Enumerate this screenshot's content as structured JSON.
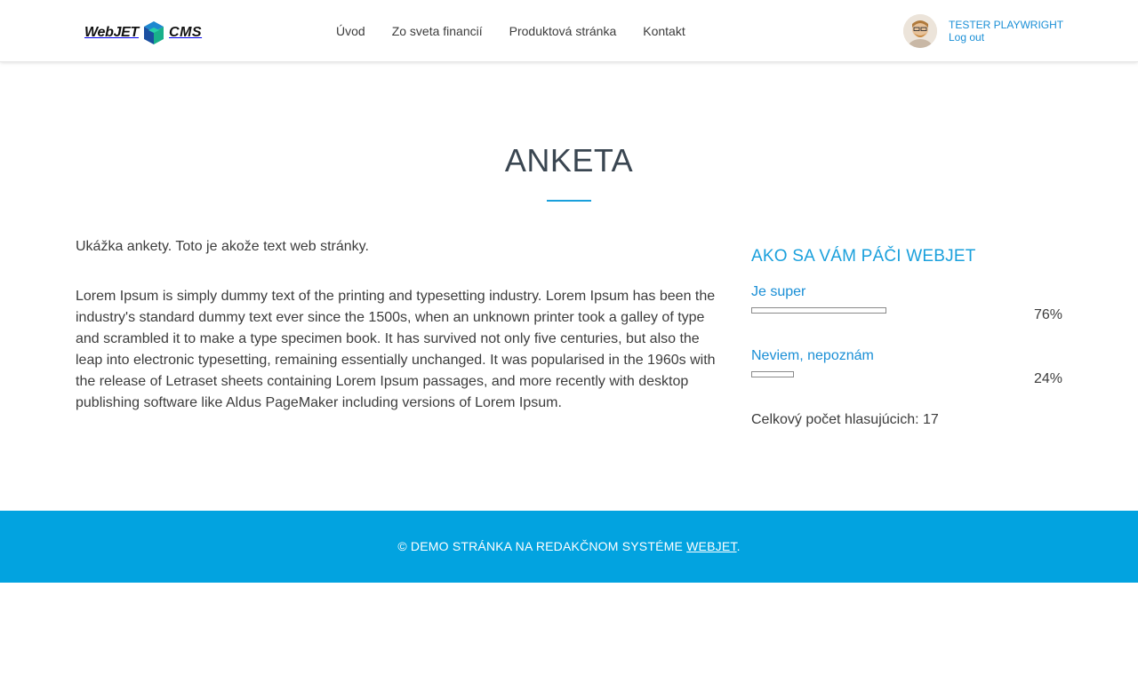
{
  "header": {
    "logo": {
      "text_left": "WebJET",
      "text_right": "CMS"
    },
    "nav": [
      {
        "label": "Úvod"
      },
      {
        "label": "Zo sveta financií"
      },
      {
        "label": "Produktová stránka"
      },
      {
        "label": "Kontakt"
      }
    ],
    "user": {
      "name": "TESTER PLAYWRIGHT",
      "logout": "Log out"
    }
  },
  "main": {
    "title": "ANKETA",
    "intro": "Ukážka ankety. Toto je akože text web stránky.",
    "lorem": "Lorem Ipsum is simply dummy text of the printing and typesetting industry. Lorem Ipsum has been the industry's standard dummy text ever since the 1500s, when an unknown printer took a galley of type and scrambled it to make a type specimen book. It has survived not only five centuries, but also the leap into electronic typesetting, remaining essentially unchanged. It was popularised in the 1960s with the release of Letraset sheets containing Lorem Ipsum passages, and more recently with desktop publishing software like Aldus PageMaker including versions of Lorem Ipsum."
  },
  "poll": {
    "question": "AKO SA VÁM PÁČI WEBJET",
    "answers": [
      {
        "label": "Je super",
        "percent": "76%",
        "fraction": 0.76
      },
      {
        "label": "Neviem, nepoznám",
        "percent": "24%",
        "fraction": 0.24
      }
    ],
    "total": "Celkový počet hlasujúcich: 17"
  },
  "footer": {
    "text": "© DEMO STRÁNKA NA REDAKČNOM SYSTÉME ",
    "link": "WEBJET",
    "suffix": "."
  },
  "colors": {
    "accent": "#1aa0dc",
    "link": "#1a8fd6",
    "footer_bg": "#02a3e0"
  }
}
